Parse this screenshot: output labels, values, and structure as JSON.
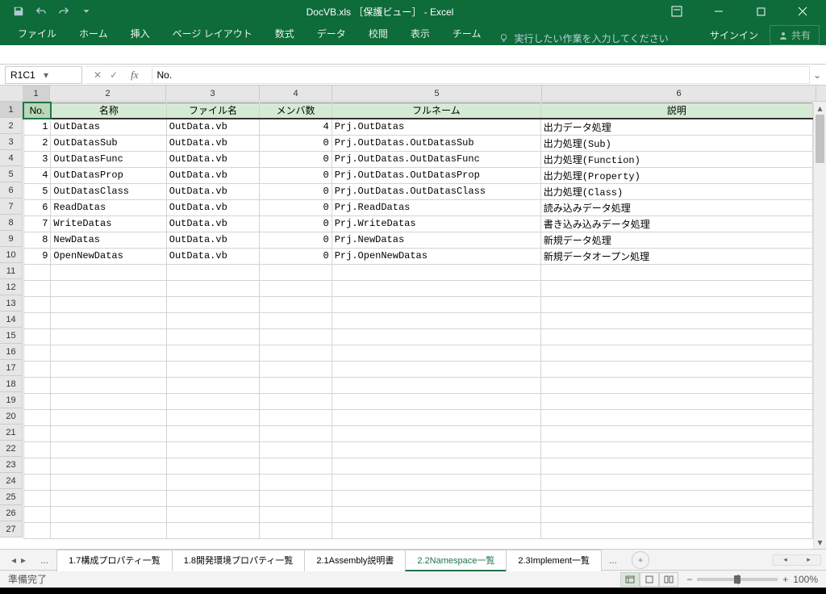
{
  "window": {
    "title": "DocVB.xls ［保護ビュー］ - Excel"
  },
  "ribbon": {
    "tabs": [
      "ファイル",
      "ホーム",
      "挿入",
      "ページ レイアウト",
      "数式",
      "データ",
      "校閲",
      "表示",
      "チーム"
    ],
    "tellme": "実行したい作業を入力してください",
    "signin": "サインイン",
    "share": "共有"
  },
  "fx": {
    "namebox": "R1C1",
    "formula": "No."
  },
  "columns": [
    "1",
    "2",
    "3",
    "4",
    "5",
    "6"
  ],
  "headers": {
    "no": "No.",
    "name": "名称",
    "file": "ファイル名",
    "members": "メンバ数",
    "fullname": "フルネーム",
    "desc": "説明"
  },
  "rows": [
    {
      "no": "1",
      "name": "OutDatas",
      "file": "OutData.vb",
      "members": "4",
      "fullname": "Prj.OutDatas",
      "desc": "出力データ処理"
    },
    {
      "no": "2",
      "name": "OutDatasSub",
      "file": "OutData.vb",
      "members": "0",
      "fullname": "Prj.OutDatas.OutDatasSub",
      "desc": "出力処理(Sub)"
    },
    {
      "no": "3",
      "name": "OutDatasFunc",
      "file": "OutData.vb",
      "members": "0",
      "fullname": "Prj.OutDatas.OutDatasFunc",
      "desc": "出力処理(Function)"
    },
    {
      "no": "4",
      "name": "OutDatasProp",
      "file": "OutData.vb",
      "members": "0",
      "fullname": "Prj.OutDatas.OutDatasProp",
      "desc": "出力処理(Property)"
    },
    {
      "no": "5",
      "name": "OutDatasClass",
      "file": "OutData.vb",
      "members": "0",
      "fullname": "Prj.OutDatas.OutDatasClass",
      "desc": "出力処理(Class)"
    },
    {
      "no": "6",
      "name": "ReadDatas",
      "file": "OutData.vb",
      "members": "0",
      "fullname": "Prj.ReadDatas",
      "desc": "読み込みデータ処理"
    },
    {
      "no": "7",
      "name": "WriteDatas",
      "file": "OutData.vb",
      "members": "0",
      "fullname": "Prj.WriteDatas",
      "desc": "書き込み込みデータ処理"
    },
    {
      "no": "8",
      "name": "NewDatas",
      "file": "OutData.vb",
      "members": "0",
      "fullname": "Prj.NewDatas",
      "desc": "新規データ処理"
    },
    {
      "no": "9",
      "name": "OpenNewDatas",
      "file": "OutData.vb",
      "members": "0",
      "fullname": "Prj.OpenNewDatas",
      "desc": "新規データオープン処理"
    }
  ],
  "sheets": {
    "tabs": [
      "1.7構成プロパティ一覧",
      "1.8開発環境プロパティ一覧",
      "2.1Assembly説明書",
      "2.2Namespace一覧",
      "2.3Implement一覧"
    ],
    "active": 3
  },
  "status": {
    "ready": "準備完了",
    "zoom": "100%"
  }
}
